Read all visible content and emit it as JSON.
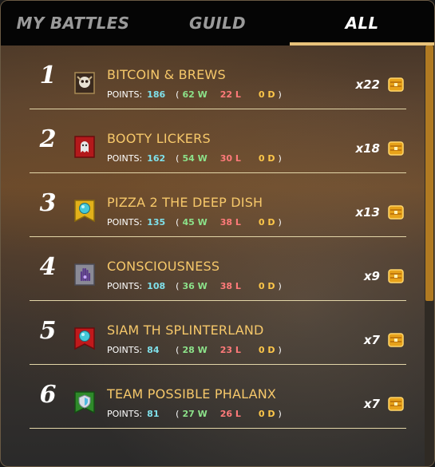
{
  "tabs": [
    {
      "label": "MY BATTLES",
      "active": false
    },
    {
      "label": "GUILD",
      "active": false
    },
    {
      "label": "ALL",
      "active": true
    }
  ],
  "labels": {
    "points": "POINTS:"
  },
  "colors": {
    "accent_gold": "#f6c86a",
    "points": "#7fe0ea",
    "wins": "#8ce28a",
    "losses": "#ff7a7a",
    "draws": "#ffc84a",
    "tab_underline": "#e8c27a"
  },
  "rows": [
    {
      "rank": "1",
      "name": "BITCOIN & BREWS",
      "points": "186",
      "wins": "62 W",
      "losses": "22 L",
      "draws": "0 D",
      "count": "x22",
      "banner": "skull-banner-icon"
    },
    {
      "rank": "2",
      "name": "BOOTY LICKERS",
      "points": "162",
      "wins": "54 W",
      "losses": "30 L",
      "draws": "0 D",
      "count": "x18",
      "banner": "ghost-banner-icon"
    },
    {
      "rank": "3",
      "name": "PIZZA 2 THE DEEP DISH",
      "points": "135",
      "wins": "45 W",
      "losses": "38 L",
      "draws": "0 D",
      "count": "x13",
      "banner": "orb-banner-icon"
    },
    {
      "rank": "4",
      "name": "CONSCIOUSNESS",
      "points": "108",
      "wins": "36 W",
      "losses": "38 L",
      "draws": "0 D",
      "count": "x9",
      "banner": "hand-banner-icon"
    },
    {
      "rank": "5",
      "name": "SIAM TH SPLINTERLAND",
      "points": "84",
      "wins": "28 W",
      "losses": "23 L",
      "draws": "0 D",
      "count": "x7",
      "banner": "orb-red-banner-icon"
    },
    {
      "rank": "6",
      "name": "TEAM POSSIBLE PHALANX",
      "points": "81",
      "wins": "27 W",
      "losses": "26 L",
      "draws": "0 D",
      "count": "x7",
      "banner": "shield-banner-icon"
    }
  ],
  "chest_icon": "treasure-chest-icon"
}
